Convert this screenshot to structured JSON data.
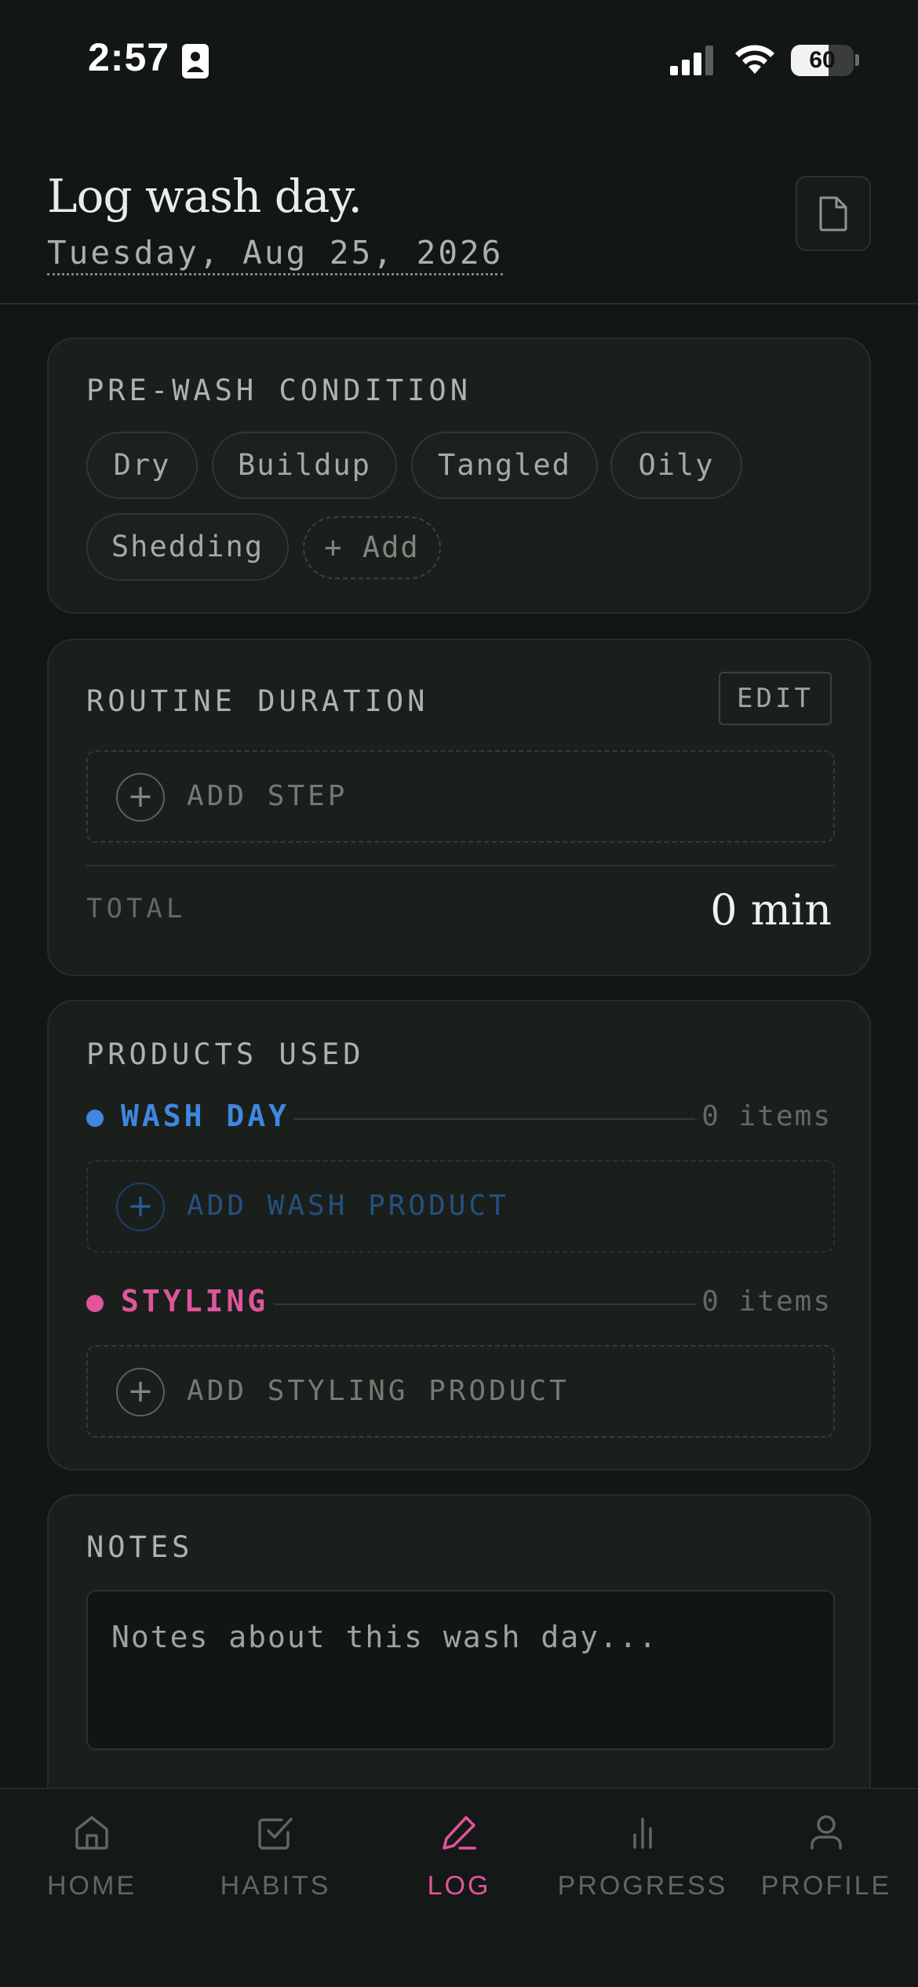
{
  "status_bar": {
    "time": "2:57",
    "battery_level": "60",
    "battery_fraction": 0.6
  },
  "header": {
    "title": "Log wash day.",
    "date": "Tuesday, Aug 25, 2026",
    "doc_icon": "document-icon"
  },
  "pre_wash": {
    "label": "PRE-WASH CONDITION",
    "chips": [
      "Dry",
      "Buildup",
      "Tangled",
      "Oily",
      "Shedding"
    ],
    "add_label": "+ Add"
  },
  "routine": {
    "label": "ROUTINE DURATION",
    "edit_label": "EDIT",
    "add_step_label": "ADD STEP",
    "total_label": "TOTAL",
    "total_value": "0 min"
  },
  "products": {
    "label": "PRODUCTS USED",
    "wash": {
      "label": "WASH DAY",
      "count": "0 items",
      "add_label": "ADD WASH PRODUCT",
      "color": "#3f87e0"
    },
    "styling": {
      "label": "STYLING",
      "count": "0 items",
      "add_label": "ADD STYLING PRODUCT",
      "color": "#e0559c"
    }
  },
  "notes": {
    "label": "NOTES",
    "placeholder": "Notes about this wash day..."
  },
  "tabs": [
    {
      "label": "HOME",
      "icon": "home-icon",
      "active": false
    },
    {
      "label": "HABITS",
      "icon": "checkbox-icon",
      "active": false
    },
    {
      "label": "LOG",
      "icon": "pencil-icon",
      "active": true
    },
    {
      "label": "PROGRESS",
      "icon": "bar-chart-icon",
      "active": false
    },
    {
      "label": "PROFILE",
      "icon": "user-icon",
      "active": false
    }
  ],
  "colors": {
    "background": "#121614",
    "card": "#1a1f1c",
    "accent_pink": "#e0559c",
    "accent_blue": "#3f87e0"
  }
}
